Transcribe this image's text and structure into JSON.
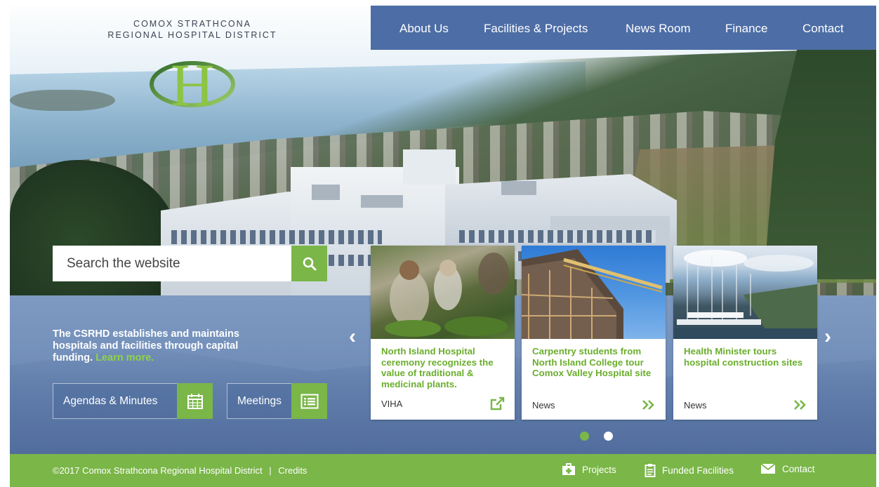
{
  "logo": {
    "line1": "COMOX STRATHCONA",
    "line2": "REGIONAL HOSPITAL DISTRICT",
    "letter": "H"
  },
  "nav": {
    "items": [
      "About Us",
      "Facilities & Projects",
      "News Room",
      "Finance",
      "Contact"
    ]
  },
  "search": {
    "placeholder": "Search the website",
    "icon": "search-icon"
  },
  "intro": {
    "text": "The CSRHD establishes and maintains hospitals and facilities through capital funding.",
    "link": "Learn more."
  },
  "buttons": {
    "agendas": {
      "label": "Agendas & Minutes",
      "icon": "calendar-icon"
    },
    "meetings": {
      "label": "Meetings",
      "icon": "list-icon"
    }
  },
  "cards": [
    {
      "title": "North Island Hospital ceremony recognizes the value of traditional & medicinal plants.",
      "tag": "VIHA",
      "icon": "external-link-icon"
    },
    {
      "title": "Carpentry students from North Island College tour Comox Valley Hospital site",
      "tag": "News",
      "icon": "double-chevron-right-icon"
    },
    {
      "title": "Health Minister tours hospital construction sites",
      "tag": "News",
      "icon": "double-chevron-right-icon"
    }
  ],
  "carousel": {
    "prev": "‹",
    "next": "›",
    "active_index": 0,
    "count": 2
  },
  "footer": {
    "copyright": "©2017 Comox Strathcona Regional Hospital District",
    "separator": "|",
    "credits": "Credits",
    "links": [
      {
        "label": "Projects",
        "icon": "medical-kit-icon"
      },
      {
        "label": "Funded Facilities",
        "icon": "clipboard-icon"
      },
      {
        "label": "Contact",
        "icon": "envelope-icon"
      }
    ]
  },
  "colors": {
    "nav": "#4d6da6",
    "accent": "#7ab648",
    "card_title": "#6aae2c",
    "footer": "#7ab648"
  }
}
